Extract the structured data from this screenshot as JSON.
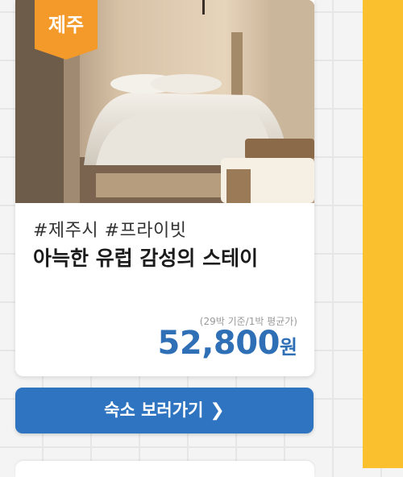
{
  "card": {
    "region_badge": "제주",
    "tags": "#제주시 #프라이빗",
    "title": "아늑한 유럽 감성의 스테이",
    "price_note": "(29박 기준/1박 평균가)",
    "price_amount": "52,800",
    "price_unit": "원"
  },
  "cta": {
    "label": "숙소 보러가기",
    "icon": "chevron-right-icon"
  },
  "colors": {
    "badge": "#f39a2b",
    "price": "#2f6fb5",
    "button": "#2f74c0",
    "side_panel": "#fbc02d"
  }
}
